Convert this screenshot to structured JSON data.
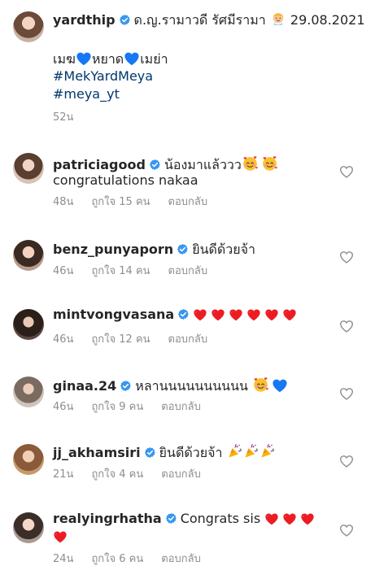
{
  "post": {
    "username": "yardthip",
    "caption_line1": "ด.ญ.รามาวดี รัศมีรามา",
    "caption_date": "29.08.2021",
    "line2_a": "เมฆ",
    "line2_b": "หยาด",
    "line2_c": "เมย่า",
    "hashtag1": "#MekYardMeya",
    "hashtag2": "#meya_yt",
    "time": "52น"
  },
  "comments": [
    {
      "username": "patriciagood",
      "text": "น้องมาแล้ววว",
      "text2": "congratulations nakaa",
      "time": "48น",
      "likes": "ถูกใจ 15 คน",
      "reply": "ตอบกลับ"
    },
    {
      "username": "benz_punyaporn",
      "text": "ยินดีด้วยจ้า",
      "time": "46น",
      "likes": "ถูกใจ 14 คน",
      "reply": "ตอบกลับ"
    },
    {
      "username": "mintvongvasana",
      "text": "",
      "time": "46น",
      "likes": "ถูกใจ 12 คน",
      "reply": "ตอบกลับ"
    },
    {
      "username": "ginaa.24",
      "text": "หลานนนนนนนนนน",
      "time": "46น",
      "likes": "ถูกใจ 9 คน",
      "reply": "ตอบกลับ"
    },
    {
      "username": "jj_akhamsiri",
      "text": "ยินดีด้วยจ้า",
      "time": "21น",
      "likes": "ถูกใจ 4 คน",
      "reply": "ตอบกลับ"
    },
    {
      "username": "realyingrhatha",
      "text": "Congrats sis",
      "time": "24น",
      "likes": "ถูกใจ 6 คน",
      "reply": "ตอบกลับ"
    }
  ],
  "colors": {
    "verified": "#3897f0",
    "heart_red": "#ed1c24",
    "blue_heart": "#1877f2",
    "secondary": "#8e8e8e",
    "link": "#00376b"
  },
  "icons": {
    "verified": "verified-badge-icon",
    "like": "heart-outline-icon"
  }
}
